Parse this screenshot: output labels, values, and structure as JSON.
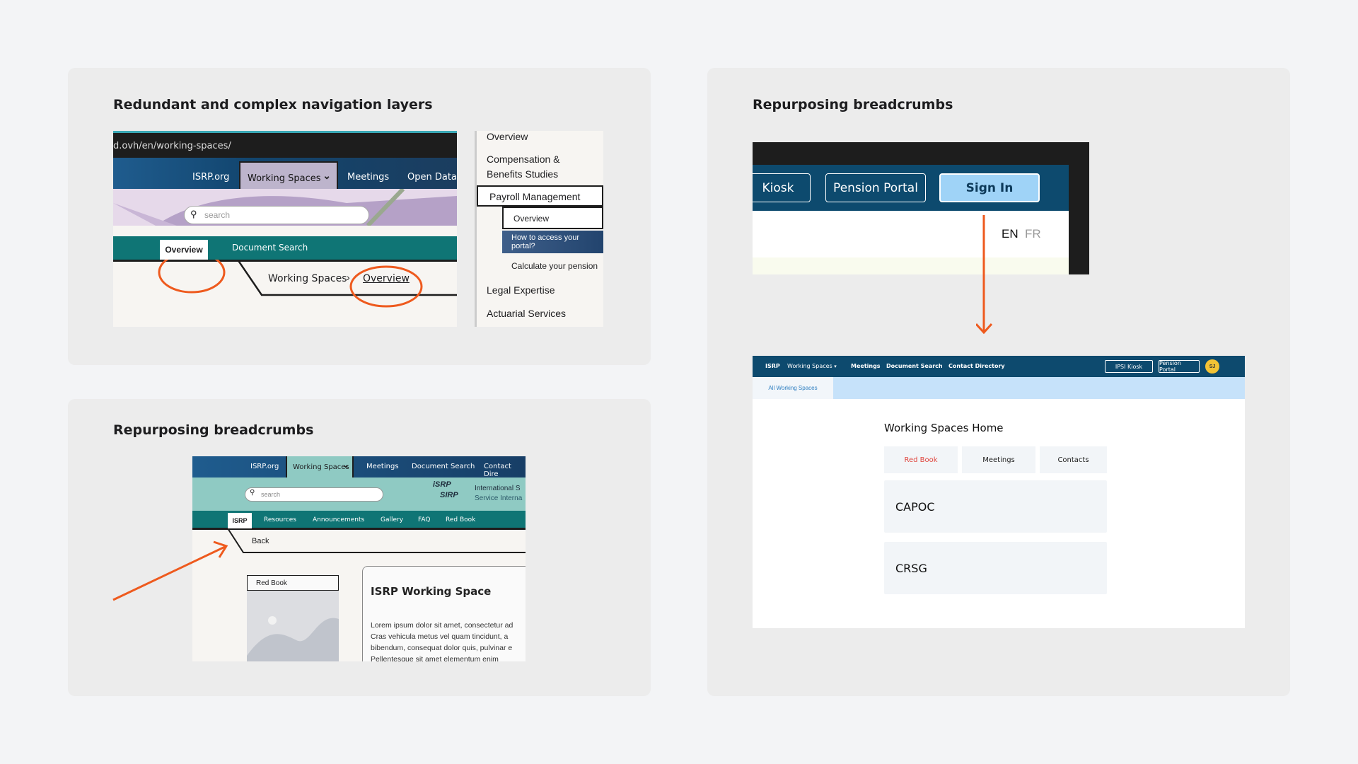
{
  "colors": {
    "accent": "#ee5a1e",
    "navy": "#0d4a6e",
    "teal": "#0f7575",
    "signin": "#9fd3f7"
  },
  "panel1": {
    "title": "Redundant and complex navigation layers",
    "url": "d.ovh/en/working-spaces/",
    "nav": [
      "ISRP.org",
      "Working Spaces",
      "Meetings",
      "Open Data"
    ],
    "search_placeholder": "search",
    "subnav": [
      "Overview",
      "Document Search"
    ],
    "breadcrumb": [
      "Working Spaces",
      "Overview"
    ],
    "menu": {
      "items": [
        "Overview",
        "Compensation & Benefits Studies",
        "Payroll Management"
      ],
      "sub_items": [
        "Overview",
        "How to access your portal?",
        "Calculate your pension"
      ],
      "more": [
        "Legal Expertise",
        "Actuarial Services"
      ]
    }
  },
  "panel2": {
    "title": "Repurposing breadcrumbs",
    "nav": [
      "ISRP.org",
      "Working Spaces",
      "Meetings",
      "Document Search",
      "Contact Dire"
    ],
    "search_placeholder": "search",
    "logo_text": [
      "iSRP",
      "SIRP"
    ],
    "org_name": [
      "International S",
      "Service Interna"
    ],
    "subnav": [
      "ISRP",
      "Resources",
      "Announcements",
      "Gallery",
      "FAQ",
      "Red Book"
    ],
    "back": "Back",
    "side_label": "Red Book",
    "heading": "ISRP Working Space",
    "body": [
      "Lorem ipsum dolor sit amet, consectetur ad",
      "Cras vehicula metus vel quam tincidunt, a",
      "bibendum, consequat dolor quis, pulvinar e",
      "Pellentesque sit amet elementum enim"
    ]
  },
  "panel3": {
    "title": "Repurposing breadcrumbs",
    "top": {
      "buttons": [
        "Kiosk",
        "Pension Portal",
        "Sign In"
      ],
      "lang": [
        "EN",
        "FR"
      ]
    },
    "bottom": {
      "logo": "ISRP",
      "nav": [
        "Working Spaces",
        "Meetings",
        "Document Search",
        "Contact Directory"
      ],
      "buttons": [
        "IPSI Kiosk",
        "Pension Portal"
      ],
      "avatar": "SJ",
      "tab": "All Working Spaces",
      "heading": "Working Spaces Home",
      "tabs": [
        "Red Book",
        "Meetings",
        "Contacts"
      ],
      "tiles": [
        "CAPOC",
        "CRSG"
      ]
    }
  }
}
